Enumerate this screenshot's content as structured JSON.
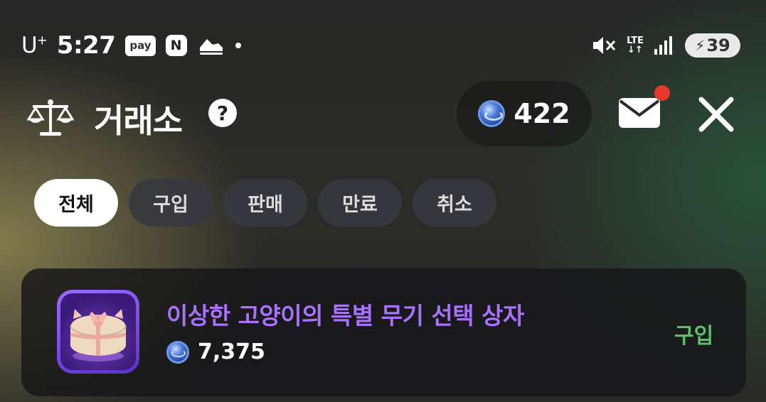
{
  "status_bar": {
    "carrier": "U",
    "carrier_sup": "+",
    "time": "5:27",
    "pay_badge": "pay",
    "n_badge": "N",
    "network_top": "LTE",
    "network_bottom": "↓↑",
    "battery": "39",
    "icons": [
      "pay-icon",
      "naver-icon",
      "shoe-icon",
      "mute-icon",
      "signal-icon",
      "battery-charging-icon"
    ]
  },
  "header": {
    "title": "거래소",
    "help_label": "?",
    "currency_value": "422",
    "icons": [
      "scale-icon",
      "help-icon",
      "coin-icon",
      "mail-icon",
      "close-icon"
    ],
    "notification_dot_color": "#e8382a"
  },
  "tabs": [
    {
      "label": "전체",
      "active": true
    },
    {
      "label": "구입",
      "active": false
    },
    {
      "label": "판매",
      "active": false
    },
    {
      "label": "만료",
      "active": false
    },
    {
      "label": "취소",
      "active": false
    }
  ],
  "transactions": [
    {
      "item_name": "이상한 고양이의 특별 무기 선택 상자",
      "price": "7,375",
      "type": "구입",
      "name_color": "#a871ff",
      "type_color": "#5cc066"
    }
  ]
}
